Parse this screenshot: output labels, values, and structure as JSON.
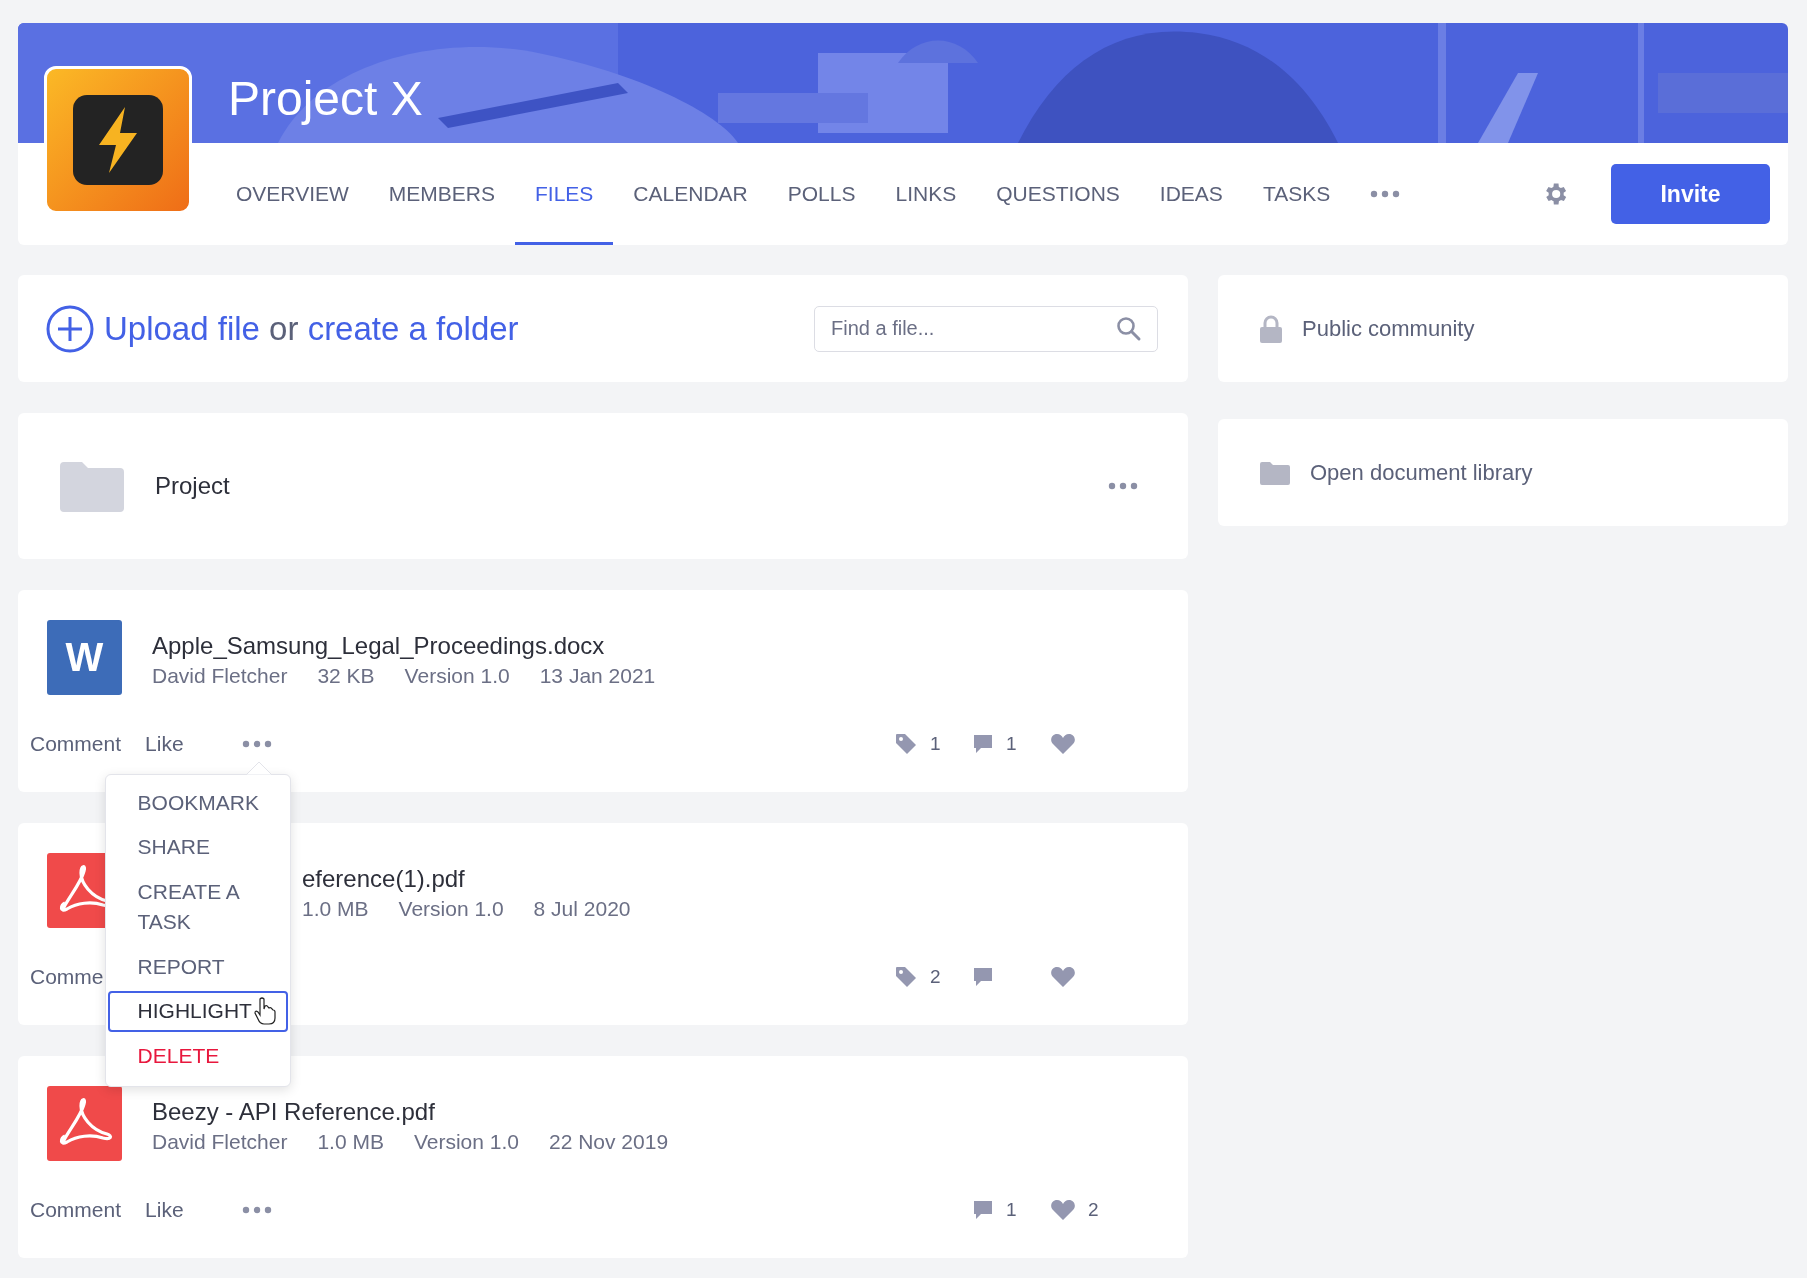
{
  "header": {
    "title": "Project X",
    "tabs": [
      {
        "label": "OVERVIEW",
        "selected": false
      },
      {
        "label": "MEMBERS",
        "selected": false
      },
      {
        "label": "FILES",
        "selected": true
      },
      {
        "label": "CALENDAR",
        "selected": false
      },
      {
        "label": "POLLS",
        "selected": false
      },
      {
        "label": "LINKS",
        "selected": false
      },
      {
        "label": "QUESTIONS",
        "selected": false
      },
      {
        "label": "IDEAS",
        "selected": false
      },
      {
        "label": "TASKS",
        "selected": false
      }
    ],
    "invite": "Invite"
  },
  "upload": {
    "link_upload": "Upload file",
    "separator": "or",
    "link_folder": "create a folder",
    "search": {
      "placeholder": "Find a file..."
    }
  },
  "folders": [
    {
      "name": "Project"
    }
  ],
  "files": [
    {
      "kind": "word",
      "icon_letter": "W",
      "name": "Apple_Samsung_Legal_Proceedings.docx",
      "meta": [
        "David Fletcher",
        "32 KB",
        "Version 1.0",
        "13 Jan 2021"
      ],
      "actions": [
        "Comment",
        "Like"
      ],
      "more": true,
      "covered": false,
      "menu_open": true,
      "stats": [
        {
          "kind": "tag",
          "count": "1"
        },
        {
          "kind": "comment",
          "count": "1"
        },
        {
          "kind": "like"
        }
      ]
    },
    {
      "kind": "pdf",
      "name": "eference(1).pdf",
      "meta": [
        "1.0 MB",
        "Version 1.0",
        "8 Jul 2020"
      ],
      "actions": [
        "Comme"
      ],
      "more": false,
      "covered": true,
      "menu_open": false,
      "stats": [
        {
          "kind": "tag",
          "count": "2"
        },
        {
          "kind": "comment"
        },
        {
          "kind": "like"
        }
      ]
    },
    {
      "kind": "pdf",
      "name": "Beezy - API Reference.pdf",
      "meta": [
        "David Fletcher",
        "1.0 MB",
        "Version 1.0",
        "22 Nov 2019"
      ],
      "actions": [
        "Comment",
        "Like"
      ],
      "more": true,
      "covered": false,
      "menu_open": false,
      "stats": [
        {
          "kind": "comment",
          "count": "1"
        },
        {
          "kind": "like",
          "count": "2"
        }
      ]
    }
  ],
  "menu": [
    {
      "label": "BOOKMARK",
      "kind": "normal",
      "selected": false
    },
    {
      "label": "SHARE",
      "kind": "normal",
      "selected": false
    },
    {
      "label": "CREATE A TASK",
      "kind": "normal",
      "selected": false
    },
    {
      "label": "REPORT",
      "kind": "normal",
      "selected": false
    },
    {
      "label": "HIGHLIGHT",
      "kind": "normal",
      "selected": true
    },
    {
      "label": "DELETE",
      "kind": "danger",
      "selected": false
    }
  ],
  "sidebar": [
    {
      "kind": "lock",
      "label": "Public community"
    },
    {
      "kind": "folder",
      "label": "Open document library"
    }
  ]
}
